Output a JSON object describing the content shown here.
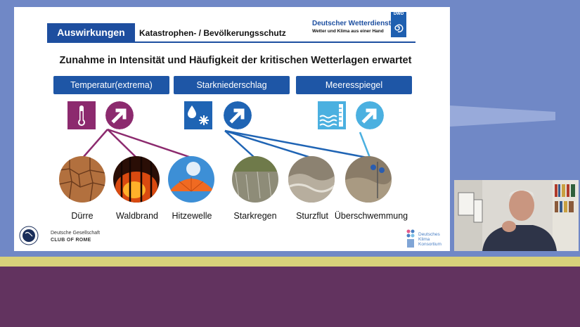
{
  "slide": {
    "section_tag": "Auswirkungen",
    "subtitle": "Katastrophen- / Bevölkerungsschutz",
    "dwd": {
      "title": "Deutscher Wetterdienst",
      "subtitle": "Wetter und Klima aus einer Hand",
      "logo_text": "DWD"
    },
    "headline": "Zunahme in Intensität und Häufigkeit der kritischen Wetterlagen erwartet",
    "categories": [
      {
        "label": "Temperatur(extrema)",
        "icon": "thermometer-icon",
        "color": "#8c2a6e"
      },
      {
        "label": "Starkniederschlag",
        "icon": "rain-snow-icon",
        "color": "#1f64b4"
      },
      {
        "label": "Meeresspiegel",
        "icon": "sea-level-icon",
        "color": "#4bb0e0"
      }
    ],
    "impacts": [
      {
        "label": "Dürre"
      },
      {
        "label": "Waldbrand"
      },
      {
        "label": "Hitzewelle"
      },
      {
        "label": "Starkregen"
      },
      {
        "label": "Sturzflut"
      },
      {
        "label": "Überschwemmung"
      }
    ],
    "footer_left": {
      "line1": "Deutsche Gesellschaft",
      "line2": "CLUB OF ROME"
    },
    "footer_right": {
      "line1": "Deutsches",
      "line2": "Klima",
      "line3": "Konsortium"
    }
  }
}
